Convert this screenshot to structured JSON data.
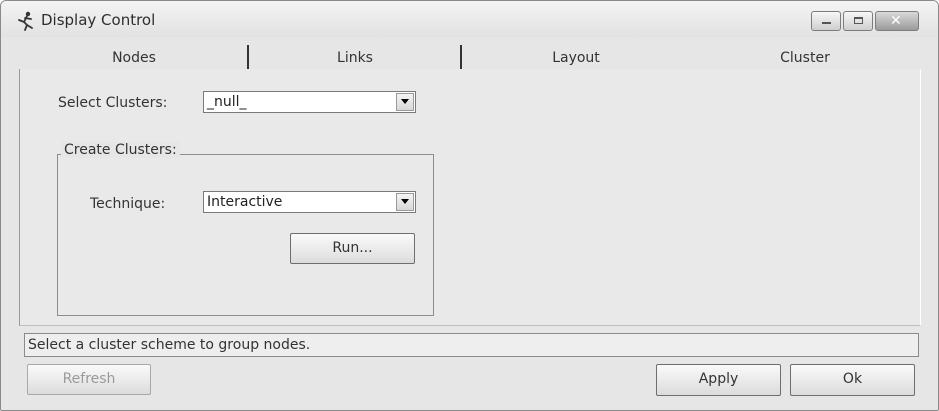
{
  "window": {
    "title": "Display Control",
    "icon": "running-figure-icon"
  },
  "tabs": [
    {
      "label": "Nodes"
    },
    {
      "label": "Links"
    },
    {
      "label": "Layout"
    },
    {
      "label": "Cluster"
    }
  ],
  "select_clusters": {
    "label": "Select Clusters:",
    "value": "_null_"
  },
  "create_clusters": {
    "legend": "Create Clusters:",
    "technique_label": "Technique:",
    "technique_value": "Interactive",
    "run_label": "Run..."
  },
  "status_text": "Select a cluster scheme to group nodes.",
  "buttons": {
    "refresh": "Refresh",
    "apply": "Apply",
    "ok": "Ok"
  }
}
